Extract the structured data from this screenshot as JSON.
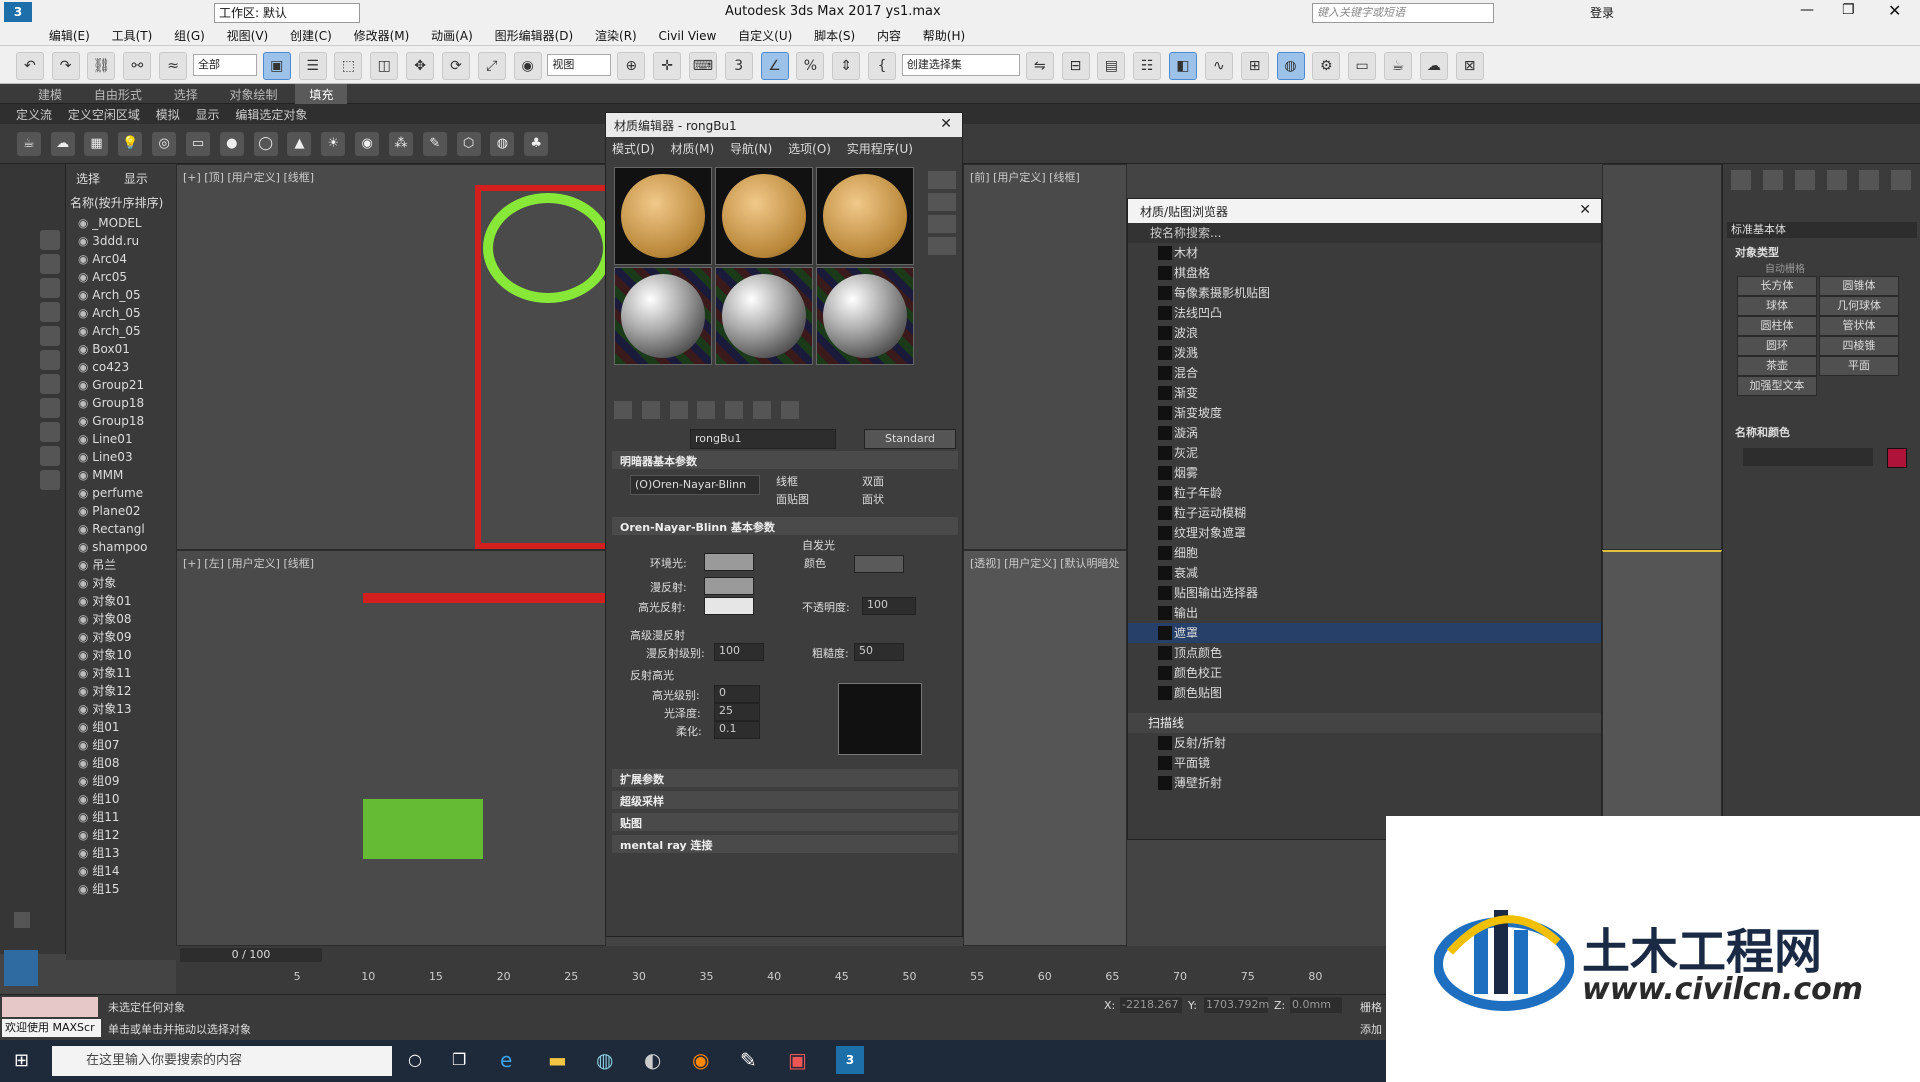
{
  "titlebar": {
    "workspace": "工作区: 默认",
    "title": "Autodesk 3ds Max 2017      ys1.max",
    "search_placeholder": "键入关键字或短语",
    "login": "登录"
  },
  "menu": [
    "编辑(E)",
    "工具(T)",
    "组(G)",
    "视图(V)",
    "创建(C)",
    "修改器(M)",
    "动画(A)",
    "图形编辑器(D)",
    "渲染(R)",
    "Civil View",
    "自定义(U)",
    "脚本(S)",
    "内容",
    "帮助(H)"
  ],
  "toolbar": {
    "filter": "全部",
    "view": "视图",
    "selection_set": "创建选择集"
  },
  "ribbon_tabs": [
    "建模",
    "自由形式",
    "选择",
    "对象绘制",
    "填充"
  ],
  "ribbon_active": "填充",
  "subribbon": [
    "定义流",
    "定义空闲区域",
    "模拟",
    "显示",
    "编辑选定对象"
  ],
  "scene": {
    "tabs": [
      "选择",
      "显示"
    ],
    "header": "名称(按升序排序)",
    "items": [
      "_MODEL",
      "3ddd.ru",
      "Arc04",
      "Arc05",
      "Arch_05",
      "Arch_05",
      "Arch_05",
      "Box01",
      "co423",
      "Group21",
      "Group18",
      "Group18",
      "Line01",
      "Line03",
      "MMM",
      "perfume",
      "Plane02",
      "Rectangl",
      "shampoo",
      "吊兰",
      "对象",
      "对象01",
      "对象08",
      "对象09",
      "对象10",
      "对象11",
      "对象12",
      "对象13",
      "组01",
      "组07",
      "组08",
      "组09",
      "组10",
      "组11",
      "组12",
      "组13",
      "组14",
      "组15"
    ]
  },
  "viewports": {
    "top": "[+] [顶] [用户定义] [线框]",
    "left": "[+] [左] [用户定义] [线框]",
    "front": "[前] [用户定义] [线框]",
    "persp": "[透视] [用户定义] [默认明暗处"
  },
  "material_editor": {
    "title": "材质编辑器 - rongBu1",
    "menu": [
      "模式(D)",
      "材质(M)",
      "导航(N)",
      "选项(O)",
      "实用程序(U)"
    ],
    "material_name": "rongBu1",
    "material_type": "Standard",
    "shader_section": "明暗器基本参数",
    "shader": "(O)Oren-Nayar-Blinn",
    "shader_opts": [
      "线框",
      "双面",
      "面贴图",
      "面状"
    ],
    "basic_section": "Oren-Nayar-Blinn 基本参数",
    "self_illum": "自发光",
    "color_label": "颜色",
    "ambient": "环境光:",
    "diffuse": "漫反射:",
    "specular": "高光反射:",
    "opacity_label": "不透明度:",
    "opacity": "100",
    "adv_diffuse": "高级漫反射",
    "diffuse_level_label": "漫反射级别:",
    "diffuse_level": "100",
    "roughness_label": "粗糙度:",
    "roughness": "50",
    "spec_section": "反射高光",
    "spec_level_label": "高光级别:",
    "spec_level": "0",
    "gloss_label": "光泽度:",
    "gloss": "25",
    "soften_label": "柔化:",
    "soften": "0.1",
    "rollouts": [
      "扩展参数",
      "超级采样",
      "贴图",
      "mental ray 连接"
    ]
  },
  "browser": {
    "title": "材质/贴图浏览器",
    "search": "按名称搜索...",
    "items": [
      "木材",
      "棋盘格",
      "每像素摄影机贴图",
      "法线凹凸",
      "波浪",
      "泼溅",
      "混合",
      "渐变",
      "渐变坡度",
      "漩涡",
      "灰泥",
      "烟雾",
      "粒子年龄",
      "粒子运动模糊",
      "纹理对象遮罩",
      "细胞",
      "衰减",
      "贴图输出选择器",
      "输出",
      "遮罩",
      "顶点颜色",
      "颜色校正",
      "颜色贴图"
    ],
    "selected": "遮罩",
    "group2": "扫描线",
    "group2_items": [
      "反射/折射",
      "平面镜",
      "薄壁折射"
    ]
  },
  "command_panel": {
    "dropdown": "标准基本体",
    "obj_type": "对象类型",
    "autogrid": "自动栅格",
    "buttons": [
      "长方体",
      "圆锥体",
      "球体",
      "几何球体",
      "圆柱体",
      "管状体",
      "圆环",
      "四棱锥",
      "茶壶",
      "平面",
      "加强型文本"
    ],
    "name_color": "名称和颜色",
    "swatch_color": "#b0133a"
  },
  "timeline": {
    "frame": "0 / 100",
    "ticks": [
      "5",
      "10",
      "15",
      "20",
      "25",
      "30",
      "35",
      "40",
      "45",
      "50",
      "55",
      "60",
      "65",
      "70",
      "75",
      "80"
    ]
  },
  "status": {
    "welcome": "欢迎使用 MAXScr",
    "line1": "未选定任何对象",
    "line2": "单击或单击并拖动以选择对象",
    "x_label": "X:",
    "x": "-2218.267",
    "y_label": "Y:",
    "y": "1703.792m",
    "z_label": "Z:",
    "z": "0.0mm",
    "grid": "栅格",
    "add": "添加"
  },
  "taskbar": {
    "search": "在这里输入你要搜索的内容"
  },
  "watermark": {
    "cn": "土木工程网",
    "url": "www.civilcn.com"
  }
}
